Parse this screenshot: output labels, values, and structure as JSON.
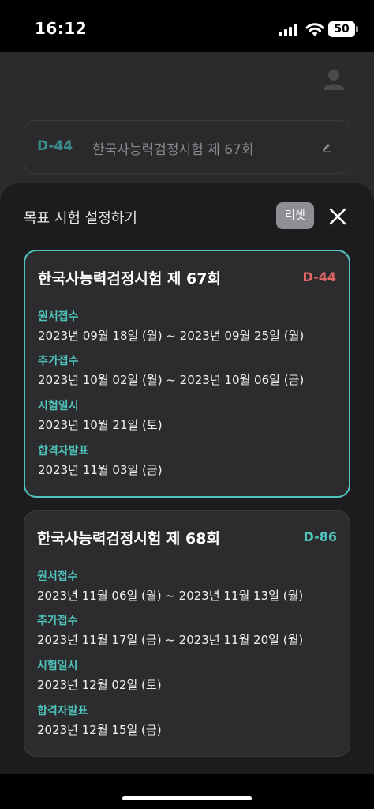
{
  "status_bar": {
    "time": "16:12",
    "battery": "50"
  },
  "goal_bar": {
    "dday": "D-44",
    "title": "한국사능력검정시험 제 67회"
  },
  "sheet": {
    "title": "목표 시험 설정하기",
    "reset_label": "리셋"
  },
  "exams": [
    {
      "title": "한국사능력검정시험 제 67회",
      "dday": "D-44",
      "dday_color": "#e06666",
      "rows": [
        {
          "label": "원서접수",
          "value": "2023년 09월 18일 (월) ~ 2023년 09월 25일 (월)"
        },
        {
          "label": "추가접수",
          "value": "2023년 10월 02일 (월) ~ 2023년 10월 06일 (금)"
        },
        {
          "label": "시험일시",
          "value": "2023년 10월 21일 (토)"
        },
        {
          "label": "합격자발표",
          "value": "2023년 11월 03일 (금)"
        }
      ]
    },
    {
      "title": "한국사능력검정시험 제 68회",
      "dday": "D-86",
      "dday_color": "#4fc3bc",
      "rows": [
        {
          "label": "원서접수",
          "value": "2023년 11월 06일 (월) ~ 2023년 11월 13일 (월)"
        },
        {
          "label": "추가접수",
          "value": "2023년 11월 17일 (금) ~ 2023년 11월 20일 (월)"
        },
        {
          "label": "시험일시",
          "value": "2023년 12월 02일 (토)"
        },
        {
          "label": "합격자발표",
          "value": "2023년 12월 15일 (금)"
        }
      ]
    }
  ],
  "colors": {
    "accent": "#4fc3bc",
    "dday_near": "#e06666"
  },
  "icons": {
    "profile": "person-icon",
    "edit": "pencil-icon",
    "close": "close-icon"
  }
}
